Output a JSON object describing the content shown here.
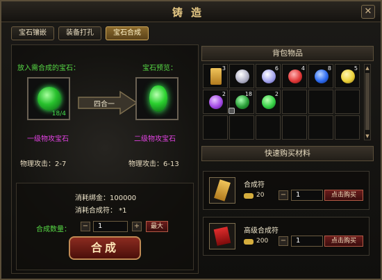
{
  "window": {
    "title": "铸造",
    "close_label": "✕"
  },
  "tabs": [
    {
      "label": "宝石镶嵌"
    },
    {
      "label": "装备打孔"
    },
    {
      "label": "宝石合成",
      "active": true
    }
  ],
  "compose": {
    "source_label": "放入需合成的宝石：",
    "preview_label": "宝石预览：",
    "source_count": "18/4",
    "arrow_label": "四合一",
    "source_name": "一级物攻宝石",
    "target_name": "二级物攻宝石",
    "source_stat": "物理攻击：2-7",
    "target_stat": "物理攻击：6-13",
    "cost_gold": "消耗绑金：100000",
    "cost_talisman": "消耗合成符：  *1",
    "quantity_label": "合成数量：",
    "quantity_value": "1",
    "minus": "−",
    "plus": "+",
    "max_label": "最大",
    "compose_button": "合成"
  },
  "bag": {
    "title": "背包物品",
    "items": [
      {
        "icon": "talisman-icon",
        "count": "3",
        "color": "#d7a440"
      },
      {
        "icon": "silver-gem-icon",
        "count": "",
        "color": "#c8c8dc"
      },
      {
        "icon": "silver-blue-gem-icon",
        "count": "6",
        "color": "#a0a0e8"
      },
      {
        "icon": "red-gem-icon",
        "count": "4",
        "color": "#e23a3a"
      },
      {
        "icon": "blue-gem-icon",
        "count": "8",
        "color": "#2f6cf0"
      },
      {
        "icon": "yellow-gem-icon",
        "count": "5",
        "color": "#ecd23a"
      },
      {
        "icon": "purple-gem-icon",
        "count": "2",
        "color": "#a44ae6"
      },
      {
        "icon": "green-gem-icon-locked",
        "count": "18",
        "color": "#2a9e38"
      },
      {
        "icon": "green-gem-icon",
        "count": "2",
        "color": "#35d045"
      }
    ],
    "scroll_up": "▲",
    "scroll_down": "▼"
  },
  "shop": {
    "title": "快速购买材料",
    "items": [
      {
        "name": "合成符",
        "price": "20",
        "quantity": "1",
        "buy_label": "点击购买"
      },
      {
        "name": "高级合成符",
        "price": "200",
        "quantity": "1",
        "buy_label": "点击购买"
      }
    ]
  }
}
